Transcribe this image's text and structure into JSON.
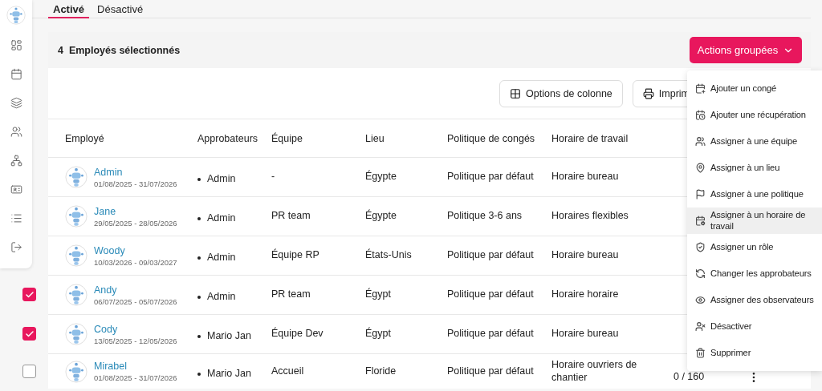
{
  "tabs": [
    {
      "label": "Activé",
      "selected": true
    },
    {
      "label": "Désactivé",
      "selected": false
    }
  ],
  "selection_bar": {
    "count_label": "4  Employés sélectionnés",
    "bulk_button": "Actions groupées"
  },
  "toolbar": {
    "buttons": [
      "Options de colonne",
      "Imprim"
    ]
  },
  "table": {
    "columns": [
      "Employé",
      "Approbateurs",
      "Équipe",
      "Lieu",
      "Politique de congés",
      "Horaire de travail"
    ],
    "rows": [
      {
        "name": "Admin",
        "dates": "01/08/2025 - 31/07/2026",
        "approver": "Admin",
        "team": "-",
        "location": "Égypte",
        "policy": "Politique par défaut",
        "schedule": "Horaire bureau"
      },
      {
        "name": "Jane",
        "dates": "29/05/2025 - 28/05/2026",
        "approver": "Admin",
        "team": "PR team",
        "location": "Égypte",
        "policy": "Politique 3-6 ans",
        "schedule": "Horaires flexibles"
      },
      {
        "name": "Woody",
        "dates": "10/03/2026 - 09/03/2027",
        "approver": "Admin",
        "team": "Équipe RP",
        "location": "États-Unis",
        "policy": "Politique par défaut",
        "schedule": "Horaire bureau"
      },
      {
        "name": "Andy",
        "dates": "06/07/2025 - 05/07/2026",
        "approver": "Admin",
        "team": "PR team",
        "location": "Égypt",
        "policy": "Politique par défaut",
        "schedule": "Horaire horaire",
        "checked": true
      },
      {
        "name": "Cody",
        "dates": "13/05/2025 - 12/05/2026",
        "approver": "Mario Jan",
        "team": "Équipe Dev",
        "location": "Égypt",
        "policy": "Politique par défaut",
        "schedule": "Horaire bureau",
        "checked": true
      },
      {
        "name": "Mirabel",
        "dates": "01/08/2025 - 31/07/2026",
        "approver": "Mario Jan",
        "team": "Accueil",
        "location": "Floride",
        "policy": "Politique par défaut",
        "schedule": "Horaire ouvriers de chantier",
        "checked": false,
        "column_7": "0 / 160"
      }
    ]
  },
  "menu": {
    "items": [
      {
        "label": "Ajouter un congé",
        "highlighted": false
      },
      {
        "label": "Ajouter une récupération",
        "highlighted": false
      },
      {
        "label": "Assigner à une équipe",
        "highlighted": false
      },
      {
        "label": "Assigner à un lieu",
        "highlighted": false
      },
      {
        "label": "Assigner à une politique",
        "highlighted": false
      },
      {
        "label": "Assigner à un horaire de travail",
        "highlighted": true
      },
      {
        "label": "Assigner un rôle",
        "highlighted": false
      },
      {
        "label": "Changer les approbateurs",
        "highlighted": false
      },
      {
        "label": "Assigner des observateurs",
        "highlighted": false
      },
      {
        "label": "Désactiver",
        "highlighted": false
      },
      {
        "label": "Supprimer",
        "highlighted": false
      }
    ]
  }
}
